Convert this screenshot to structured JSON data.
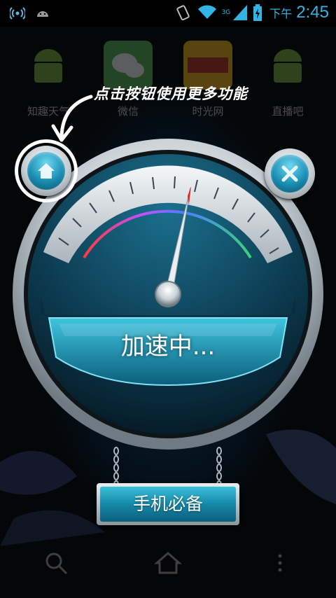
{
  "status_bar": {
    "time_prefix": "下午",
    "time": "2:45",
    "network_label": "3G",
    "icons": [
      "wireless-icon",
      "android-icon",
      "rotate-icon",
      "wifi-icon",
      "signal-icon",
      "battery-charging-icon"
    ]
  },
  "home_screen": {
    "apps": [
      {
        "label": "知趣天气",
        "icon": "android-app-icon"
      },
      {
        "label": "微信",
        "icon": "wechat-icon"
      },
      {
        "label": "时光网",
        "icon": "mtime-icon"
      },
      {
        "label": "直播吧",
        "icon": "android-app-icon"
      }
    ]
  },
  "hint": {
    "text": "点击按钮使用更多功能"
  },
  "gauge": {
    "status_text": "加速中...",
    "needle_icon": "needle-icon"
  },
  "buttons": {
    "home_icon": "home-icon",
    "close_icon": "close-icon",
    "action_label": "手机必备"
  },
  "nav_bar": {
    "icons": [
      "search-icon",
      "home-icon",
      "menu-icon"
    ]
  },
  "colors": {
    "accent": "#32b5e5",
    "panel": "#1a8fb4"
  }
}
